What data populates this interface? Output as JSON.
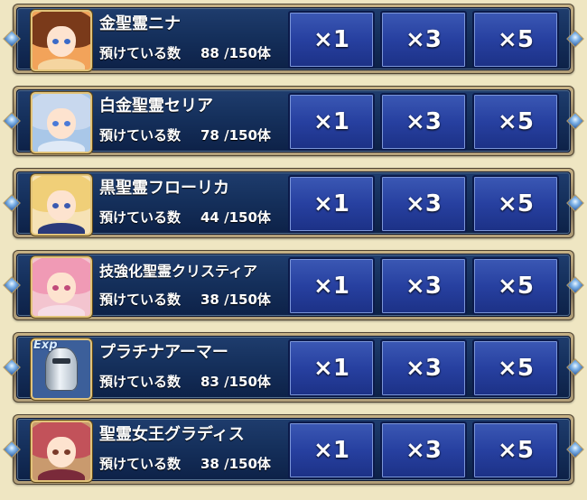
{
  "stock_label": "預けている数",
  "buttons": [
    "×1",
    "×3",
    "×5"
  ],
  "rows": [
    {
      "name": "金聖霊ニナ",
      "count": "88 /150体",
      "icon": "spirit-nina-portrait",
      "colors": {
        "bg": "#f2a35a",
        "hair": "#7a3a1a",
        "eye": "#3a6ac8",
        "body": "#f5d5a0"
      }
    },
    {
      "name": "白金聖霊セリア",
      "count": "78 /150体",
      "icon": "spirit-celia-portrait",
      "colors": {
        "bg": "#a9c7e8",
        "hair": "#c8d8ee",
        "eye": "#4a7ad8",
        "body": "#dfe9f6"
      }
    },
    {
      "name": "黒聖霊フローリカ",
      "count": "44 /150体",
      "icon": "spirit-florika-portrait",
      "colors": {
        "bg": "#f6e2b5",
        "hair": "#f0cf78",
        "eye": "#3a5ab0",
        "body": "#2a3a7a"
      }
    },
    {
      "name": "技強化聖霊クリスティア",
      "count": "38 /150体",
      "icon": "spirit-christia-portrait",
      "colors": {
        "bg": "#f3c4cf",
        "hair": "#f09ab5",
        "eye": "#c04a7a",
        "body": "#f6dde6"
      }
    },
    {
      "name": "プラチナアーマー",
      "count": "83 /150体",
      "icon": "platinum-armor-icon",
      "exp": "Exp",
      "colors": {
        "bg": "#3c5f9a",
        "hair": "#3c5f9a",
        "eye": "#3c5f9a",
        "body": "#6a8ac0"
      }
    },
    {
      "name": "聖霊女王グラディス",
      "count": "38 /150体",
      "icon": "spirit-queen-gladys-portrait",
      "colors": {
        "bg": "#c99a6e",
        "hair": "#c2525a",
        "eye": "#7a3a2a",
        "body": "#7a2a3a"
      }
    }
  ]
}
